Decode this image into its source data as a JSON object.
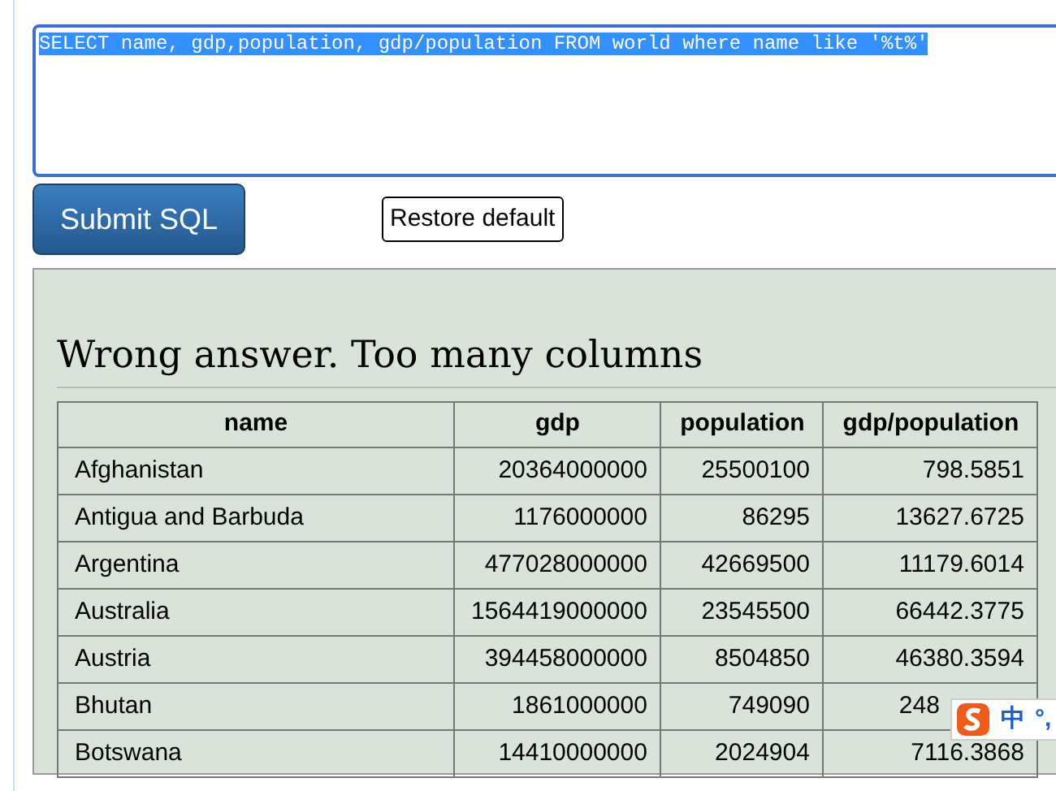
{
  "query": {
    "value": "SELECT name, gdp,population, gdp/population FROM world where name like '%t%'",
    "selected": true
  },
  "buttons": {
    "submit": "Submit SQL",
    "restore": "Restore default"
  },
  "result": {
    "heading": "Wrong answer. Too many columns",
    "columns": [
      "name",
      "gdp",
      "population",
      "gdp/population"
    ],
    "rows": [
      {
        "cells": [
          "Afghanistan",
          "20364000000",
          "25500100",
          "798.5851"
        ]
      },
      {
        "cells": [
          "Antigua and Barbuda",
          "1176000000",
          "86295",
          "13627.6725"
        ]
      },
      {
        "cells": [
          "Argentina",
          "477028000000",
          "42669500",
          "11179.6014"
        ]
      },
      {
        "cells": [
          "Australia",
          "1564419000000",
          "23545500",
          "66442.3775"
        ]
      },
      {
        "cells": [
          "Austria",
          "394458000000",
          "8504850",
          "46380.3594"
        ]
      },
      {
        "cells": [
          "Bhutan",
          "1861000000",
          "749090",
          "248"
        ],
        "covered": true
      },
      {
        "cells": [
          "Botswana",
          "14410000000",
          "2024904",
          "7116.3868"
        ]
      }
    ]
  },
  "ime_toolbar": {
    "mode": "中",
    "punctuation": "°,"
  }
}
